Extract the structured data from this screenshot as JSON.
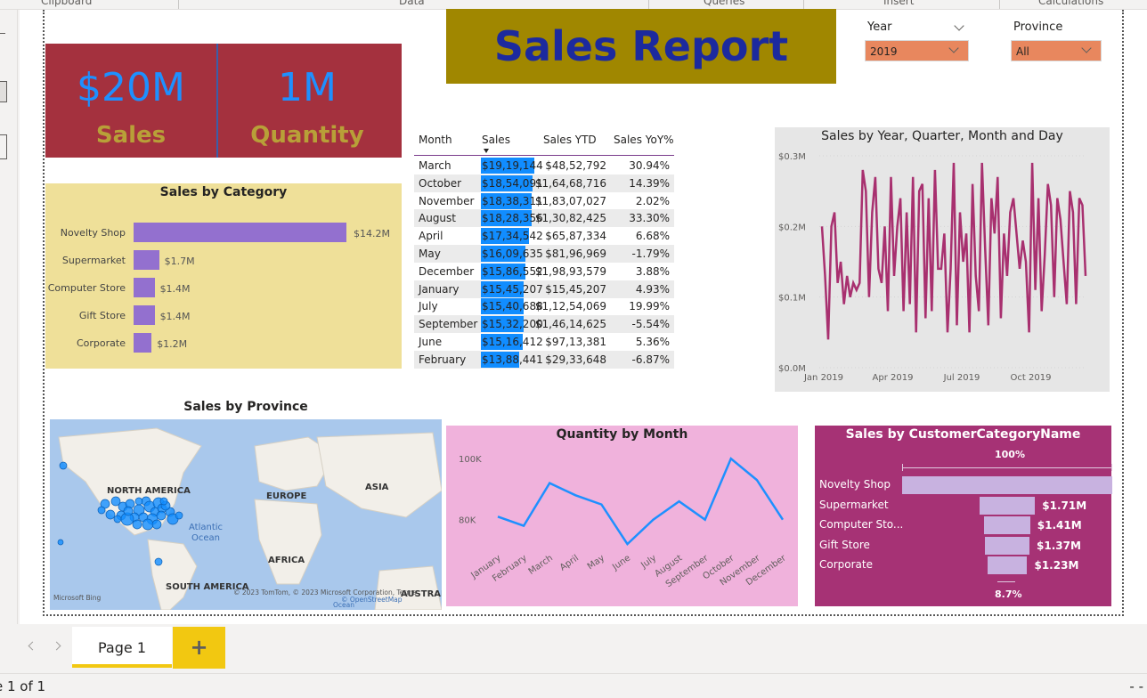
{
  "ribbon": {
    "groups": [
      "Clipboard",
      "Data",
      "Queries",
      "Insert",
      "Calculations"
    ]
  },
  "title": "Sales Report",
  "kpis": {
    "sales_value": "$20M",
    "sales_label": "Sales",
    "quantity_value": "1M",
    "quantity_label": "Quantity"
  },
  "slicers": {
    "year": {
      "label": "Year",
      "value": "2019"
    },
    "province": {
      "label": "Province",
      "value": "All"
    }
  },
  "colors": {
    "kpi_bg": "#a4313e",
    "title_bg": "#a08700",
    "title_text": "#1c2a9e",
    "category_bg": "#efe099",
    "bar": "#9370cf",
    "table_bar": "#118dff",
    "line": "#a8306f",
    "quantity_bg": "#f0b2dc",
    "quantity_line": "#1e90ff",
    "customer_bg": "#a63275",
    "page_tab_accent": "#f2c811"
  },
  "category_chart": {
    "title": "Sales by Category",
    "items": [
      {
        "label": "Novelty Shop",
        "value": 14.2,
        "value_label": "$14.2M"
      },
      {
        "label": "Supermarket",
        "value": 1.7,
        "value_label": "$1.7M"
      },
      {
        "label": "Computer Store",
        "value": 1.4,
        "value_label": "$1.4M"
      },
      {
        "label": "Gift Store",
        "value": 1.4,
        "value_label": "$1.4M"
      },
      {
        "label": "Corporate",
        "value": 1.2,
        "value_label": "$1.2M"
      }
    ]
  },
  "table": {
    "headers": [
      "Month",
      "Sales",
      "Sales YTD",
      "Sales YoY%"
    ],
    "rows": [
      {
        "month": "March",
        "sales": "$19,19,144",
        "ytd": "$48,52,792",
        "yoy": "30.94%",
        "fill": 1.0
      },
      {
        "month": "October",
        "sales": "$18,54,091",
        "ytd": "$1,64,68,716",
        "yoy": "14.39%",
        "fill": 0.966
      },
      {
        "month": "November",
        "sales": "$18,38,311",
        "ytd": "$1,83,07,027",
        "yoy": "2.02%",
        "fill": 0.958
      },
      {
        "month": "August",
        "sales": "$18,28,356",
        "ytd": "$1,30,82,425",
        "yoy": "33.30%",
        "fill": 0.953
      },
      {
        "month": "April",
        "sales": "$17,34,542",
        "ytd": "$65,87,334",
        "yoy": "6.68%",
        "fill": 0.904
      },
      {
        "month": "May",
        "sales": "$16,09,635",
        "ytd": "$81,96,969",
        "yoy": "-1.79%",
        "fill": 0.839
      },
      {
        "month": "December",
        "sales": "$15,86,552",
        "ytd": "$1,98,93,579",
        "yoy": "3.88%",
        "fill": 0.827
      },
      {
        "month": "January",
        "sales": "$15,45,207",
        "ytd": "$15,45,207",
        "yoy": "4.93%",
        "fill": 0.805
      },
      {
        "month": "July",
        "sales": "$15,40,688",
        "ytd": "$1,12,54,069",
        "yoy": "19.99%",
        "fill": 0.803
      },
      {
        "month": "September",
        "sales": "$15,32,200",
        "ytd": "$1,46,14,625",
        "yoy": "-5.54%",
        "fill": 0.798
      },
      {
        "month": "June",
        "sales": "$15,16,412",
        "ytd": "$97,13,381",
        "yoy": "5.36%",
        "fill": 0.79
      },
      {
        "month": "February",
        "sales": "$13,88,441",
        "ytd": "$29,33,648",
        "yoy": "-6.87%",
        "fill": 0.723
      }
    ]
  },
  "chart_data": [
    {
      "type": "line",
      "title": "Sales by Year, Quarter, Month and Day",
      "xlabel": "",
      "ylabel": "",
      "y_ticks": [
        "$0.0M",
        "$0.1M",
        "$0.2M",
        "$0.3M"
      ],
      "x_ticks": [
        "Jan 2019",
        "Apr 2019",
        "Jul 2019",
        "Oct 2019"
      ],
      "ylim": [
        0,
        0.3
      ],
      "series": [
        {
          "values": [
            0.2,
            0.13,
            0.04,
            0.2,
            0.22,
            0.12,
            0.15,
            0.09,
            0.13,
            0.1,
            0.12,
            0.11,
            0.12,
            0.28,
            0.25,
            0.1,
            0.22,
            0.27,
            0.14,
            0.12,
            0.2,
            0.08,
            0.27,
            0.13,
            0.2,
            0.24,
            0.08,
            0.22,
            0.09,
            0.27,
            0.05,
            0.25,
            0.26,
            0.07,
            0.24,
            0.08,
            0.28,
            0.14,
            0.14,
            0.19,
            0.05,
            0.14,
            0.29,
            0.06,
            0.22,
            0.15,
            0.19,
            0.05,
            0.26,
            0.13,
            0.08,
            0.29,
            0.17,
            0.06,
            0.24,
            0.19,
            0.27,
            0.07,
            0.19,
            0.13,
            0.22,
            0.24,
            0.19,
            0.14,
            0.18,
            0.15,
            0.05,
            0.29,
            0.11,
            0.24,
            0.08,
            0.16,
            0.26,
            0.23,
            0.1,
            0.24,
            0.21,
            0.15,
            0.09,
            0.25,
            0.22,
            0.09,
            0.24,
            0.23,
            0.13
          ]
        }
      ]
    },
    {
      "type": "line",
      "title": "Quantity by Month",
      "xlabel": "",
      "ylabel": "",
      "categories": [
        "January",
        "February",
        "March",
        "April",
        "May",
        "June",
        "July",
        "August",
        "September",
        "October",
        "November",
        "December"
      ],
      "y_ticks": [
        "80K",
        "100K"
      ],
      "ylim": [
        70,
        105
      ],
      "series": [
        {
          "values": [
            81,
            78,
            92,
            88,
            85,
            72,
            80,
            86,
            80,
            100,
            93,
            80
          ]
        }
      ]
    },
    {
      "type": "bar",
      "title": "Sales by CustomerCategoryName",
      "categories": [
        "Novelty Shop",
        "Supermarket",
        "Computer Sto...",
        "Gift Store",
        "Corporate"
      ],
      "value_labels": [
        "",
        "$1.71M",
        "$1.41M",
        "$1.37M",
        "$1.23M"
      ],
      "values": [
        14.2,
        1.71,
        1.41,
        1.37,
        1.23
      ],
      "top_label": "100%",
      "bottom_label": "8.7%"
    }
  ],
  "map": {
    "title": "Sales by Province",
    "continents": [
      "NORTH AMERICA",
      "EUROPE",
      "ASIA",
      "AFRICA",
      "SOUTH AMERICA",
      "AUSTRAL"
    ],
    "ocean": "Atlantic\nOcean",
    "logo": "Microsoft Bing",
    "credit": "© 2023 TomTom, © 2023 Microsoft Corporation,  Terms",
    "osm": "© OpenStreetMap",
    "ocean2": "Ocean"
  },
  "footer": {
    "page_tab": "Page 1",
    "add_page": "+",
    "status": "e 1 of 1",
    "status_right": "- -"
  }
}
